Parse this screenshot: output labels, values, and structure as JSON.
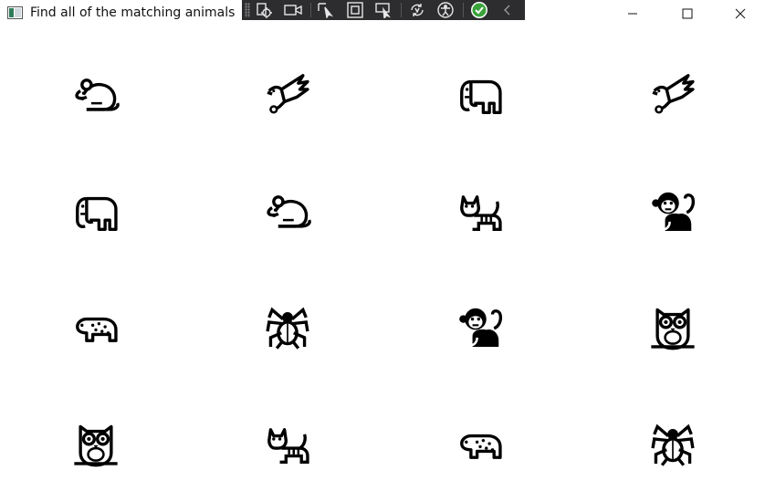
{
  "window": {
    "title": "Find all of the matching animals"
  },
  "colors": {
    "toolbar_bg": "#2d2d30",
    "toolbar_icon": "#e6e6e6",
    "check_green": "#3aa23a",
    "animal": "#000000"
  },
  "toolbar": {
    "buttons": [
      "live-visual-tree-icon",
      "video-camera-icon",
      "select-element-icon",
      "display-layout-adorners-icon",
      "track-focus-icon",
      "hot-reload-icon",
      "accessibility-icon",
      "binding-check-icon",
      "collapse-chevron-icon"
    ]
  },
  "grid": {
    "columns": 4,
    "rows": 4,
    "cells": [
      "mouse",
      "dove",
      "elephant",
      "dove",
      "elephant",
      "mouse",
      "cat",
      "monkey",
      "leopard",
      "spider",
      "monkey",
      "owl",
      "owl",
      "cat",
      "leopard",
      "spider"
    ]
  }
}
